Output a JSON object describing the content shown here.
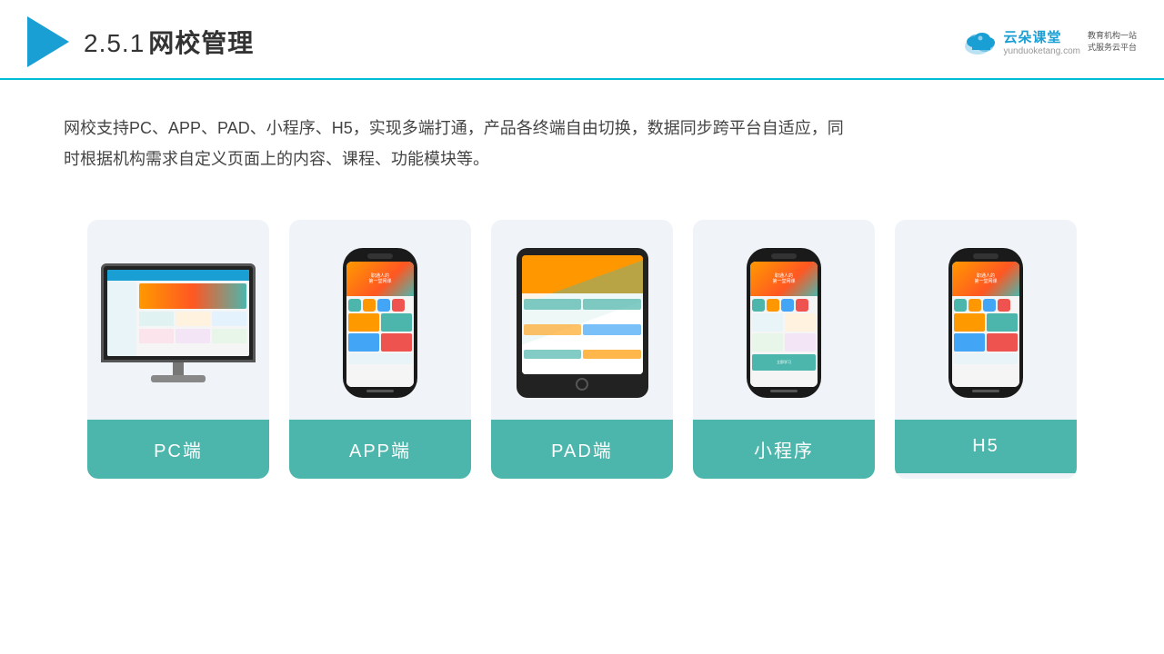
{
  "header": {
    "section_num": "2.5.1",
    "section_title": "网校管理",
    "logo_main": "云朵课堂",
    "logo_url": "yunduoketang.com",
    "logo_tagline": "教育机构一站\n式服务云平台"
  },
  "description": {
    "text": "网校支持PC、APP、PAD、小程序、H5，实现多端打通，产品各终端自由切换，数据同步跨平台自适应，同时根据机构需求自定义页面上的内容、课程、功能模块等。"
  },
  "cards": [
    {
      "id": "pc",
      "label": "PC端"
    },
    {
      "id": "app",
      "label": "APP端"
    },
    {
      "id": "pad",
      "label": "PAD端"
    },
    {
      "id": "miniprogram",
      "label": "小程序"
    },
    {
      "id": "h5",
      "label": "H5"
    }
  ],
  "colors": {
    "teal": "#4db6ac",
    "blue": "#1a9fd4",
    "accent_orange": "#ff9800",
    "header_line": "#00bcd4",
    "card_bg": "#eef2f7",
    "label_bg": "#4db6ac"
  }
}
